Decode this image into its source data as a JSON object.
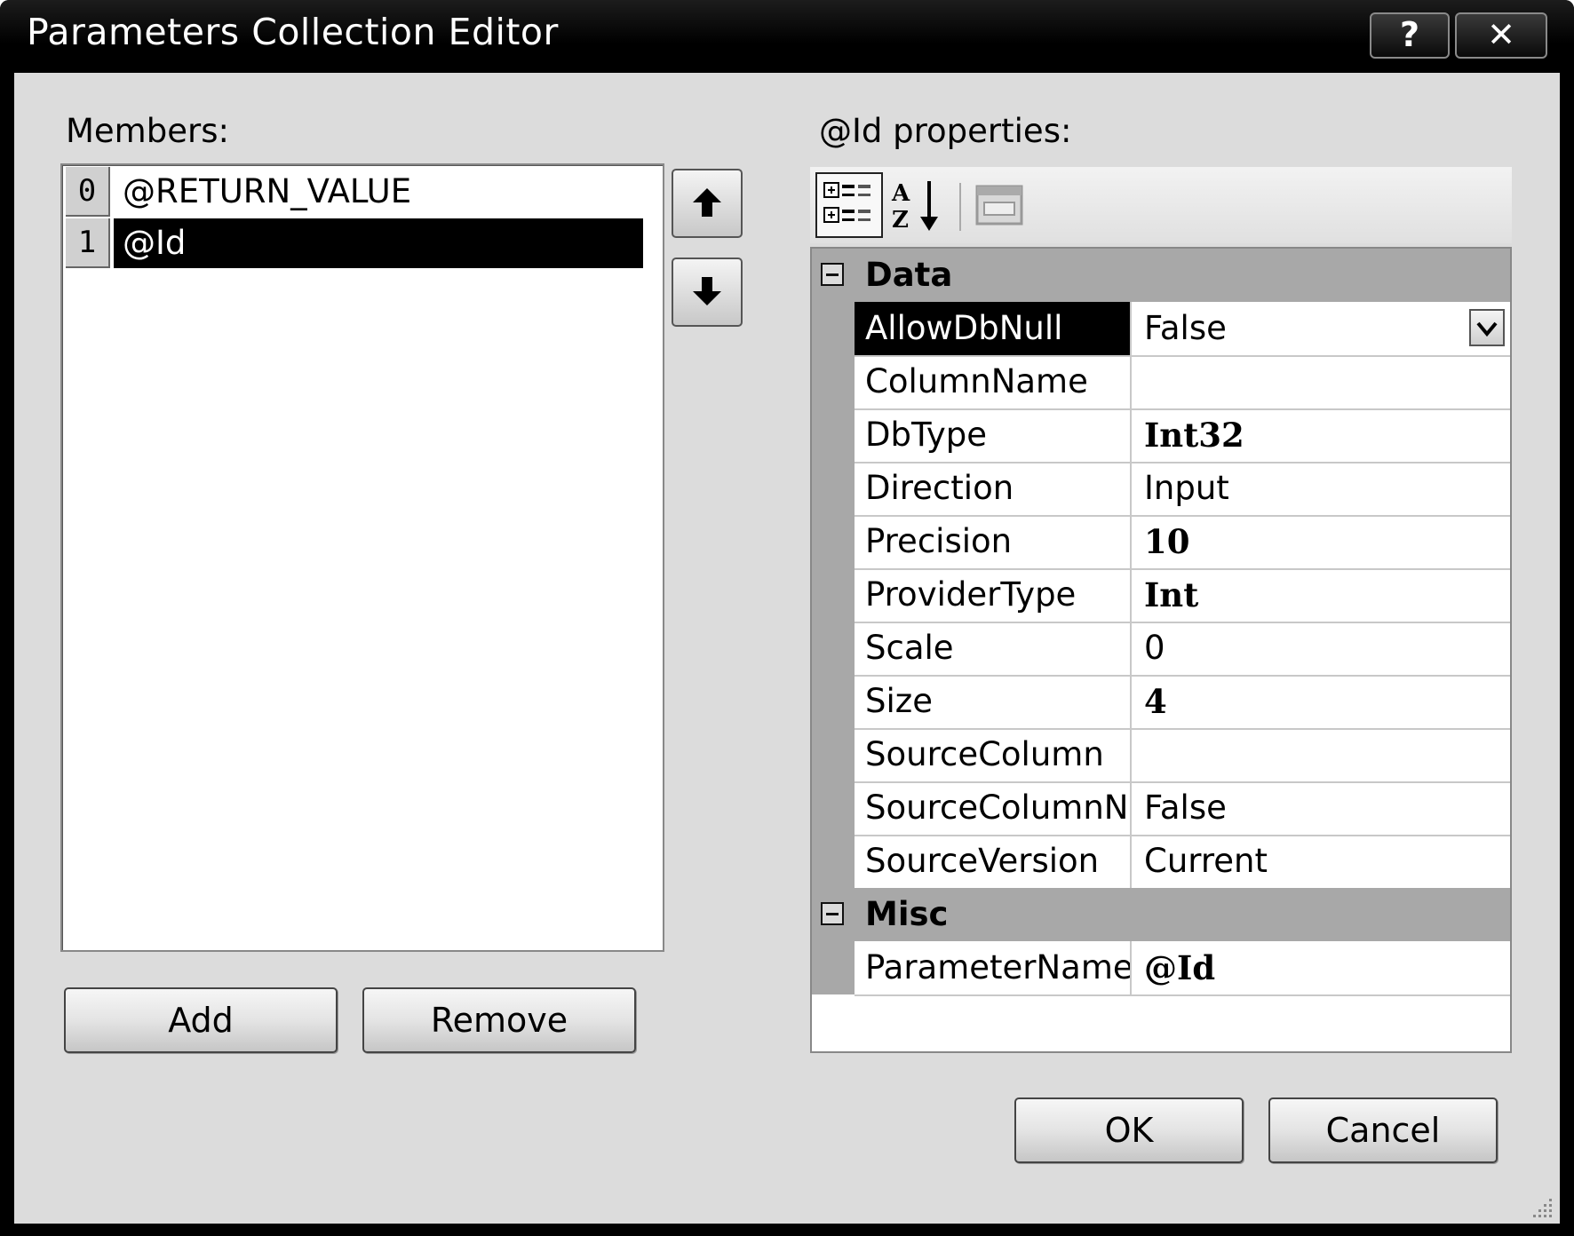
{
  "window": {
    "title": "Parameters Collection Editor",
    "help_label": "?",
    "close_label": "✕"
  },
  "members": {
    "label": "Members:",
    "items": [
      {
        "index": "0",
        "name": "@RETURN_VALUE"
      },
      {
        "index": "1",
        "name": "@Id"
      }
    ],
    "selected_index": 1,
    "add_label": "Add",
    "remove_label": "Remove"
  },
  "properties": {
    "label": "@Id properties:",
    "categories": [
      {
        "name": "Data",
        "rows": [
          {
            "name": "AllowDbNull",
            "value": "False"
          },
          {
            "name": "ColumnName",
            "value": ""
          },
          {
            "name": "DbType",
            "value": "Int32"
          },
          {
            "name": "Direction",
            "value": "Input"
          },
          {
            "name": "Precision",
            "value": "10"
          },
          {
            "name": "ProviderType",
            "value": "Int"
          },
          {
            "name": "Scale",
            "value": "0"
          },
          {
            "name": "Size",
            "value": "4"
          },
          {
            "name": "SourceColumn",
            "value": ""
          },
          {
            "name": "SourceColumnNull",
            "value": "False"
          },
          {
            "name": "SourceVersion",
            "value": "Current"
          }
        ]
      },
      {
        "name": "Misc",
        "rows": [
          {
            "name": "ParameterName",
            "value": "@Id"
          }
        ]
      }
    ],
    "toolbar_icons": [
      "categorized-icon",
      "alphabetical-icon",
      "property-pages-icon"
    ]
  },
  "buttons": {
    "ok_label": "OK",
    "cancel_label": "Cancel"
  }
}
